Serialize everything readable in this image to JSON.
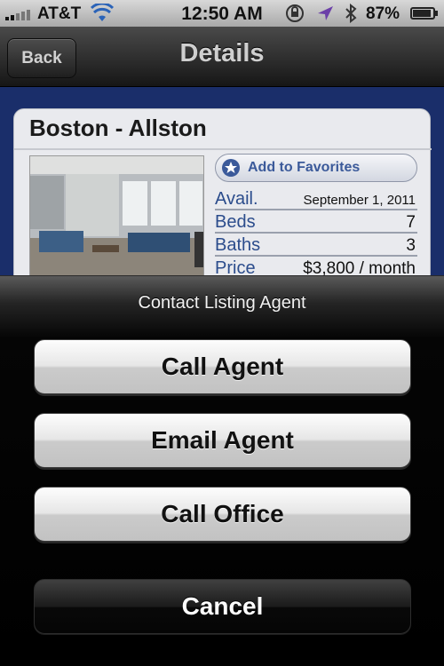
{
  "status_bar": {
    "carrier": "AT&T",
    "time": "12:50 AM",
    "battery_percent": "87%",
    "icons": [
      "signal-icon",
      "wifi-icon",
      "rotation-lock-icon",
      "location-icon",
      "bluetooth-icon",
      "battery-icon"
    ]
  },
  "nav": {
    "back_label": "Back",
    "title": "Details"
  },
  "listing": {
    "title": "Boston - Allston",
    "favorites_label": "Add to Favorites",
    "details": [
      {
        "key": "Avail.",
        "value": "September 1, 2011"
      },
      {
        "key": "Beds",
        "value": "7"
      },
      {
        "key": "Baths",
        "value": "3"
      },
      {
        "key": "Price",
        "value": "$3,800 / month"
      }
    ]
  },
  "sheet": {
    "title": "Contact Listing Agent",
    "buttons": [
      {
        "label": "Call Agent"
      },
      {
        "label": "Email Agent"
      },
      {
        "label": "Call Office"
      }
    ],
    "cancel_label": "Cancel"
  },
  "colors": {
    "content_background": "#1a2e6a",
    "link_blue": "#2b4c8c",
    "sheet_button_silver": "#e6e6e6"
  }
}
